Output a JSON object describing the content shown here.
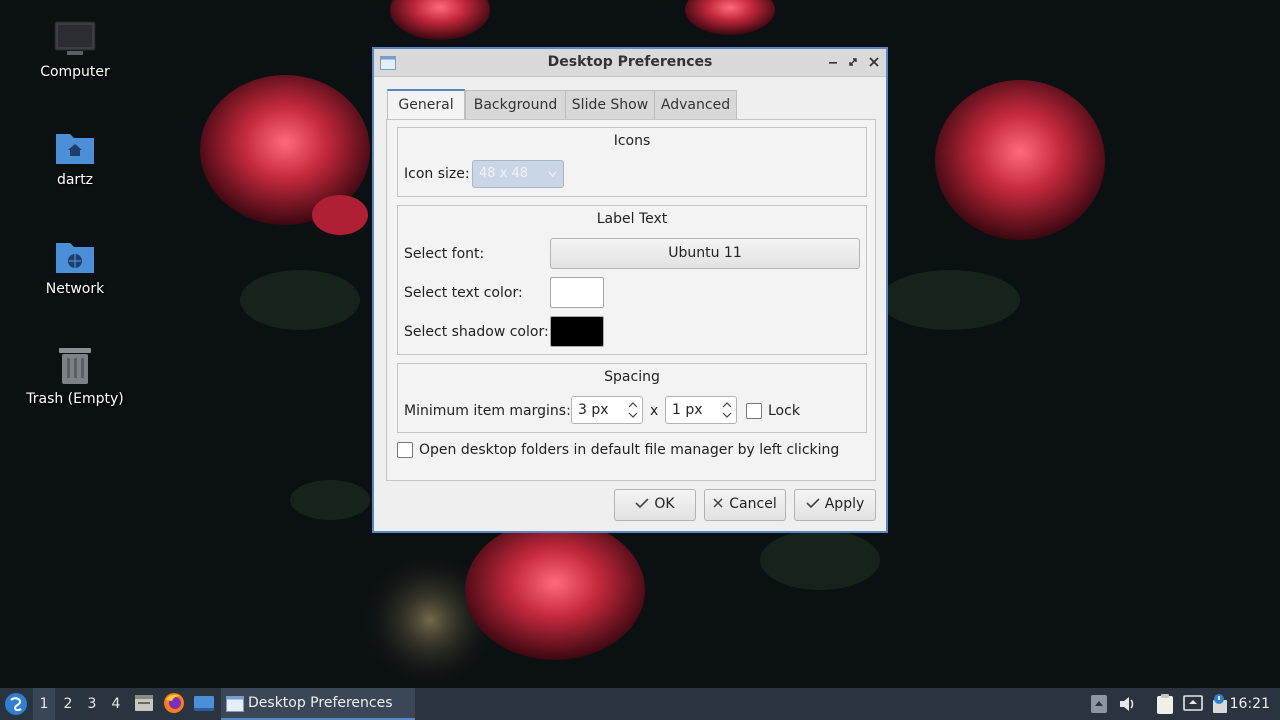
{
  "desktop": {
    "icons": [
      {
        "label": "Computer",
        "icon": "computer-icon"
      },
      {
        "label": "dartz",
        "icon": "home-folder-icon"
      },
      {
        "label": "Network",
        "icon": "network-folder-icon"
      },
      {
        "label": "Trash (Empty)",
        "icon": "trash-icon"
      }
    ]
  },
  "dialog": {
    "title": "Desktop Preferences",
    "tabs": [
      {
        "label": "General",
        "active": true
      },
      {
        "label": "Background",
        "active": false
      },
      {
        "label": "Slide Show",
        "active": false
      },
      {
        "label": "Advanced",
        "active": false
      }
    ],
    "icons_group": {
      "title": "Icons",
      "icon_size_label": "Icon size:",
      "icon_size_value": "48 x 48"
    },
    "label_text_group": {
      "title": "Label Text",
      "font_label": "Select font:",
      "font_value": "Ubuntu 11",
      "text_color_label": "Select text color:",
      "text_color": "#ffffff",
      "shadow_color_label": "Select shadow color:",
      "shadow_color": "#000000"
    },
    "spacing_group": {
      "title": "Spacing",
      "margins_label": "Minimum item margins:",
      "margin_x": "3 px",
      "separator": "x",
      "margin_y": "1 px",
      "lock_label": "Lock",
      "lock_checked": false
    },
    "open_folders_label": "Open desktop folders in default file manager by left clicking",
    "open_folders_checked": false,
    "buttons": {
      "ok": "OK",
      "cancel": "Cancel",
      "apply": "Apply"
    }
  },
  "taskbar": {
    "workspaces": [
      "1",
      "2",
      "3",
      "4"
    ],
    "active_workspace": "1",
    "task_label": "Desktop Preferences",
    "clock": "16:21"
  },
  "colors": {
    "accent": "#5a86c2",
    "taskbar_bg": "#2a3440",
    "folder_blue": "#4a8fd8"
  }
}
